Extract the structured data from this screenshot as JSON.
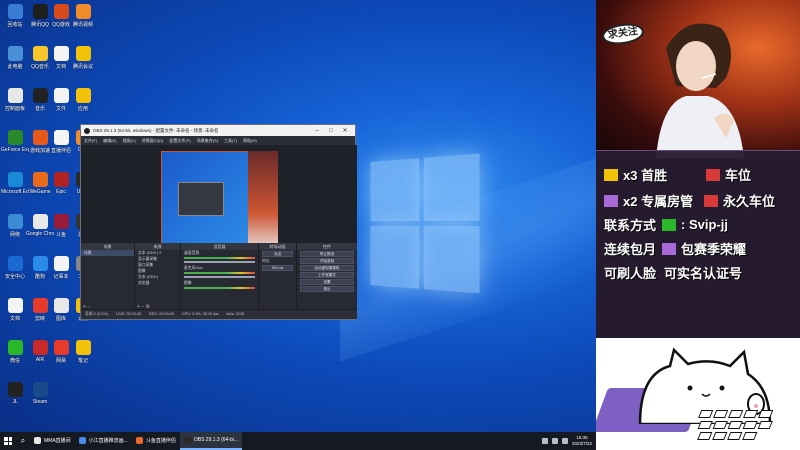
{
  "desktop": {
    "icons": [
      {
        "label": "回收站",
        "color": "#3a7bd5"
      },
      {
        "label": "腾讯QQ",
        "color": "#1e1e1e"
      },
      {
        "label": "QQ游戏",
        "color": "#d84a1a"
      },
      {
        "label": "腾讯视频",
        "color": "#f08a2a"
      },
      {
        "label": "此电脑",
        "color": "#4a90d9"
      },
      {
        "label": "QQ音乐",
        "color": "#f6c52a"
      },
      {
        "label": "文档",
        "color": "#f4f4f4"
      },
      {
        "label": "腾讯会议",
        "color": "#f2c10a"
      },
      {
        "label": "控制面板",
        "color": "#e8e8e8"
      },
      {
        "label": "音乐",
        "color": "#222222"
      },
      {
        "label": "文件",
        "color": "#f4f4f4"
      },
      {
        "label": "应用",
        "color": "#f2c10a"
      },
      {
        "label": "GeForce Experience",
        "color": "#2a8a2a"
      },
      {
        "label": "游戏加速",
        "color": "#e85a1a"
      },
      {
        "label": "直播伴侣",
        "color": "#f4f4f4"
      },
      {
        "label": "OBS",
        "color": "#f08a2a"
      },
      {
        "label": "Microsoft Edge",
        "color": "#1a8ad4"
      },
      {
        "label": "WeGame",
        "color": "#e86a1a"
      },
      {
        "label": "Epic",
        "color": "#b22222"
      },
      {
        "label": "Uplay",
        "color": "#2a2a2a"
      },
      {
        "label": "网络",
        "color": "#3a8ad4"
      },
      {
        "label": "Google Chrome",
        "color": "#e8e8e8"
      },
      {
        "label": "斗鱼",
        "color": "#9a1a3a"
      },
      {
        "label": "游戏",
        "color": "#333333"
      },
      {
        "label": "安全中心",
        "color": "#1a6ad4"
      },
      {
        "label": "酷狗",
        "color": "#2a8ae8"
      },
      {
        "label": "记事本",
        "color": "#f4f4f4"
      },
      {
        "label": "工具",
        "color": "#888888"
      },
      {
        "label": "文档",
        "color": "#f4f4f4"
      },
      {
        "label": "剪映",
        "color": "#e83a2a"
      },
      {
        "label": "图库",
        "color": "#e8e8e8"
      },
      {
        "label": "设置",
        "color": "#f2c10a"
      },
      {
        "label": "微信",
        "color": "#2ab82a"
      },
      {
        "label": "AIR",
        "color": "#c82a2a"
      },
      {
        "label": "网易",
        "color": "#e83a2a"
      },
      {
        "label": "笔记",
        "color": "#f2c10a"
      },
      {
        "label": "JL",
        "color": "#222222"
      },
      {
        "label": "Steam",
        "color": "#1a4a8a"
      }
    ]
  },
  "obs": {
    "title": "OBS 29.1.3 (64-bit, windows) - 配置文件: 未命名 - 场景: 未命名",
    "menu": [
      "文件(F)",
      "编辑(E)",
      "视图(V)",
      "停靠窗口(D)",
      "配置文件(P)",
      "场景集合(S)",
      "工具(T)",
      "帮助(H)"
    ],
    "docks": {
      "scenes": {
        "header": "场景",
        "items": [
          "场景"
        ]
      },
      "sources": {
        "header": "来源",
        "items": [
          "文本 (GDI+) 2",
          "显示器采集",
          "窗口采集",
          "图像",
          "文本 (GDI+)",
          "浏览器"
        ]
      },
      "mixer": {
        "header": "混音器",
        "items": [
          "桌面音频",
          "麦克风/Aux",
          "图像"
        ]
      },
      "transitions": {
        "header": "转场动画",
        "type": "淡出",
        "duration_label": "时长",
        "duration": "300 ms"
      },
      "controls": {
        "header": "控件",
        "buttons": [
          "停止推流",
          "开始录制",
          "启动虚拟摄像机",
          "工作室模式",
          "设置",
          "退出"
        ]
      }
    },
    "status": [
      "丢帧 0 (0.0%)",
      "LIVE: 00:23:45",
      "REC: 00:00:00",
      "CPU: 3.5%, 30.00 fps",
      "kb/s: 3245"
    ]
  },
  "taskbar": {
    "tasks": [
      {
        "label": "MMA直播间",
        "color": "#e8e8e8",
        "active": false
      },
      {
        "label": "小江直播推流画...",
        "color": "#4a8ae8",
        "active": false
      },
      {
        "label": "斗鱼直播伴侣",
        "color": "#e86a2a",
        "active": false
      },
      {
        "label": "OBS 29.1.3 (64-bi...",
        "color": "#2a2a2a",
        "active": true
      }
    ],
    "time": "15:35",
    "date": "2023/7/22"
  },
  "panel": {
    "bubble": "求关注",
    "rows": [
      {
        "text": "x3 首胜",
        "badge": "#f2c10a"
      },
      {
        "text": "车位",
        "badge": "#d83a3a"
      },
      {
        "text": "x2 专属房管",
        "badge": "#a86ad8"
      },
      {
        "text": "永久车位",
        "badge": "#d83a3a"
      },
      {
        "text": "联系方式",
        "badge": ""
      },
      {
        "text": ": Svip-jj",
        "badge": "#2ab82a"
      },
      {
        "text": "连续包月",
        "badge": ""
      },
      {
        "text": "包赛季荣耀",
        "badge": "#a86ad8"
      },
      {
        "text": "可刷人脸",
        "badge": ""
      },
      {
        "text": "可实名认证号",
        "badge": ""
      }
    ]
  },
  "colors": {
    "accent": "#7e5fc4",
    "desktop_blue": "#1662d6"
  }
}
